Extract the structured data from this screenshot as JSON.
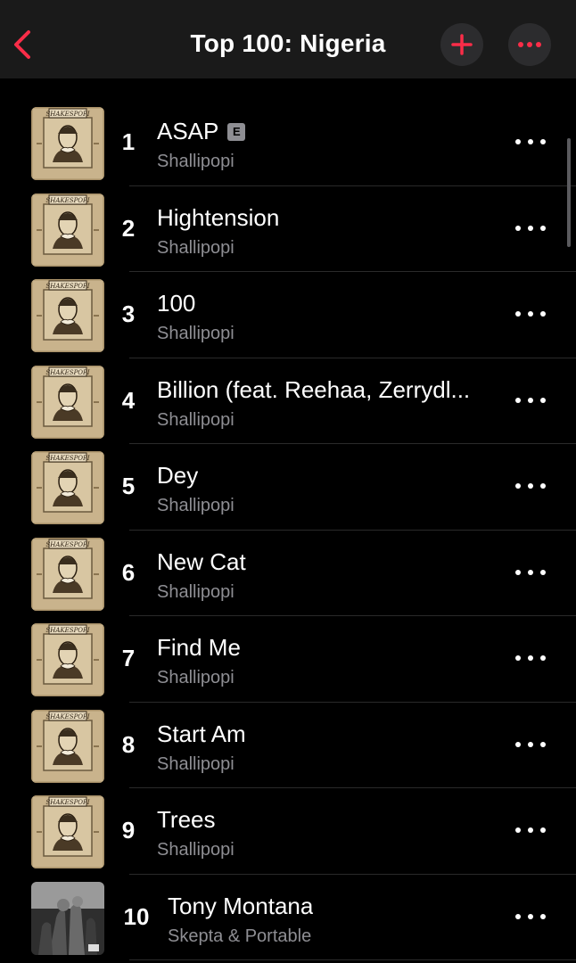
{
  "header": {
    "title": "Top 100: Nigeria",
    "accent_color": "#fa2d48"
  },
  "tracks": [
    {
      "rank": "1",
      "title": "ASAP",
      "explicit": "E",
      "artist": "Shallipopi",
      "art": "shakespopi-cover"
    },
    {
      "rank": "2",
      "title": "Hightension",
      "artist": "Shallipopi",
      "art": "shakespopi-cover"
    },
    {
      "rank": "3",
      "title": "100",
      "artist": "Shallipopi",
      "art": "shakespopi-cover"
    },
    {
      "rank": "4",
      "title": "Billion (feat. Reehaa, Zerrydl...",
      "artist": "Shallipopi",
      "art": "shakespopi-cover"
    },
    {
      "rank": "5",
      "title": "Dey",
      "artist": "Shallipopi",
      "art": "shakespopi-cover"
    },
    {
      "rank": "6",
      "title": "New Cat",
      "artist": "Shallipopi",
      "art": "shakespopi-cover"
    },
    {
      "rank": "7",
      "title": "Find Me",
      "artist": "Shallipopi",
      "art": "shakespopi-cover"
    },
    {
      "rank": "8",
      "title": "Start Am",
      "artist": "Shallipopi",
      "art": "shakespopi-cover"
    },
    {
      "rank": "9",
      "title": "Trees",
      "artist": "Shallipopi",
      "art": "shakespopi-cover"
    },
    {
      "rank": "10",
      "title": "Tony Montana",
      "artist": "Skepta & Portable",
      "art": "tony-montana-cover"
    }
  ]
}
